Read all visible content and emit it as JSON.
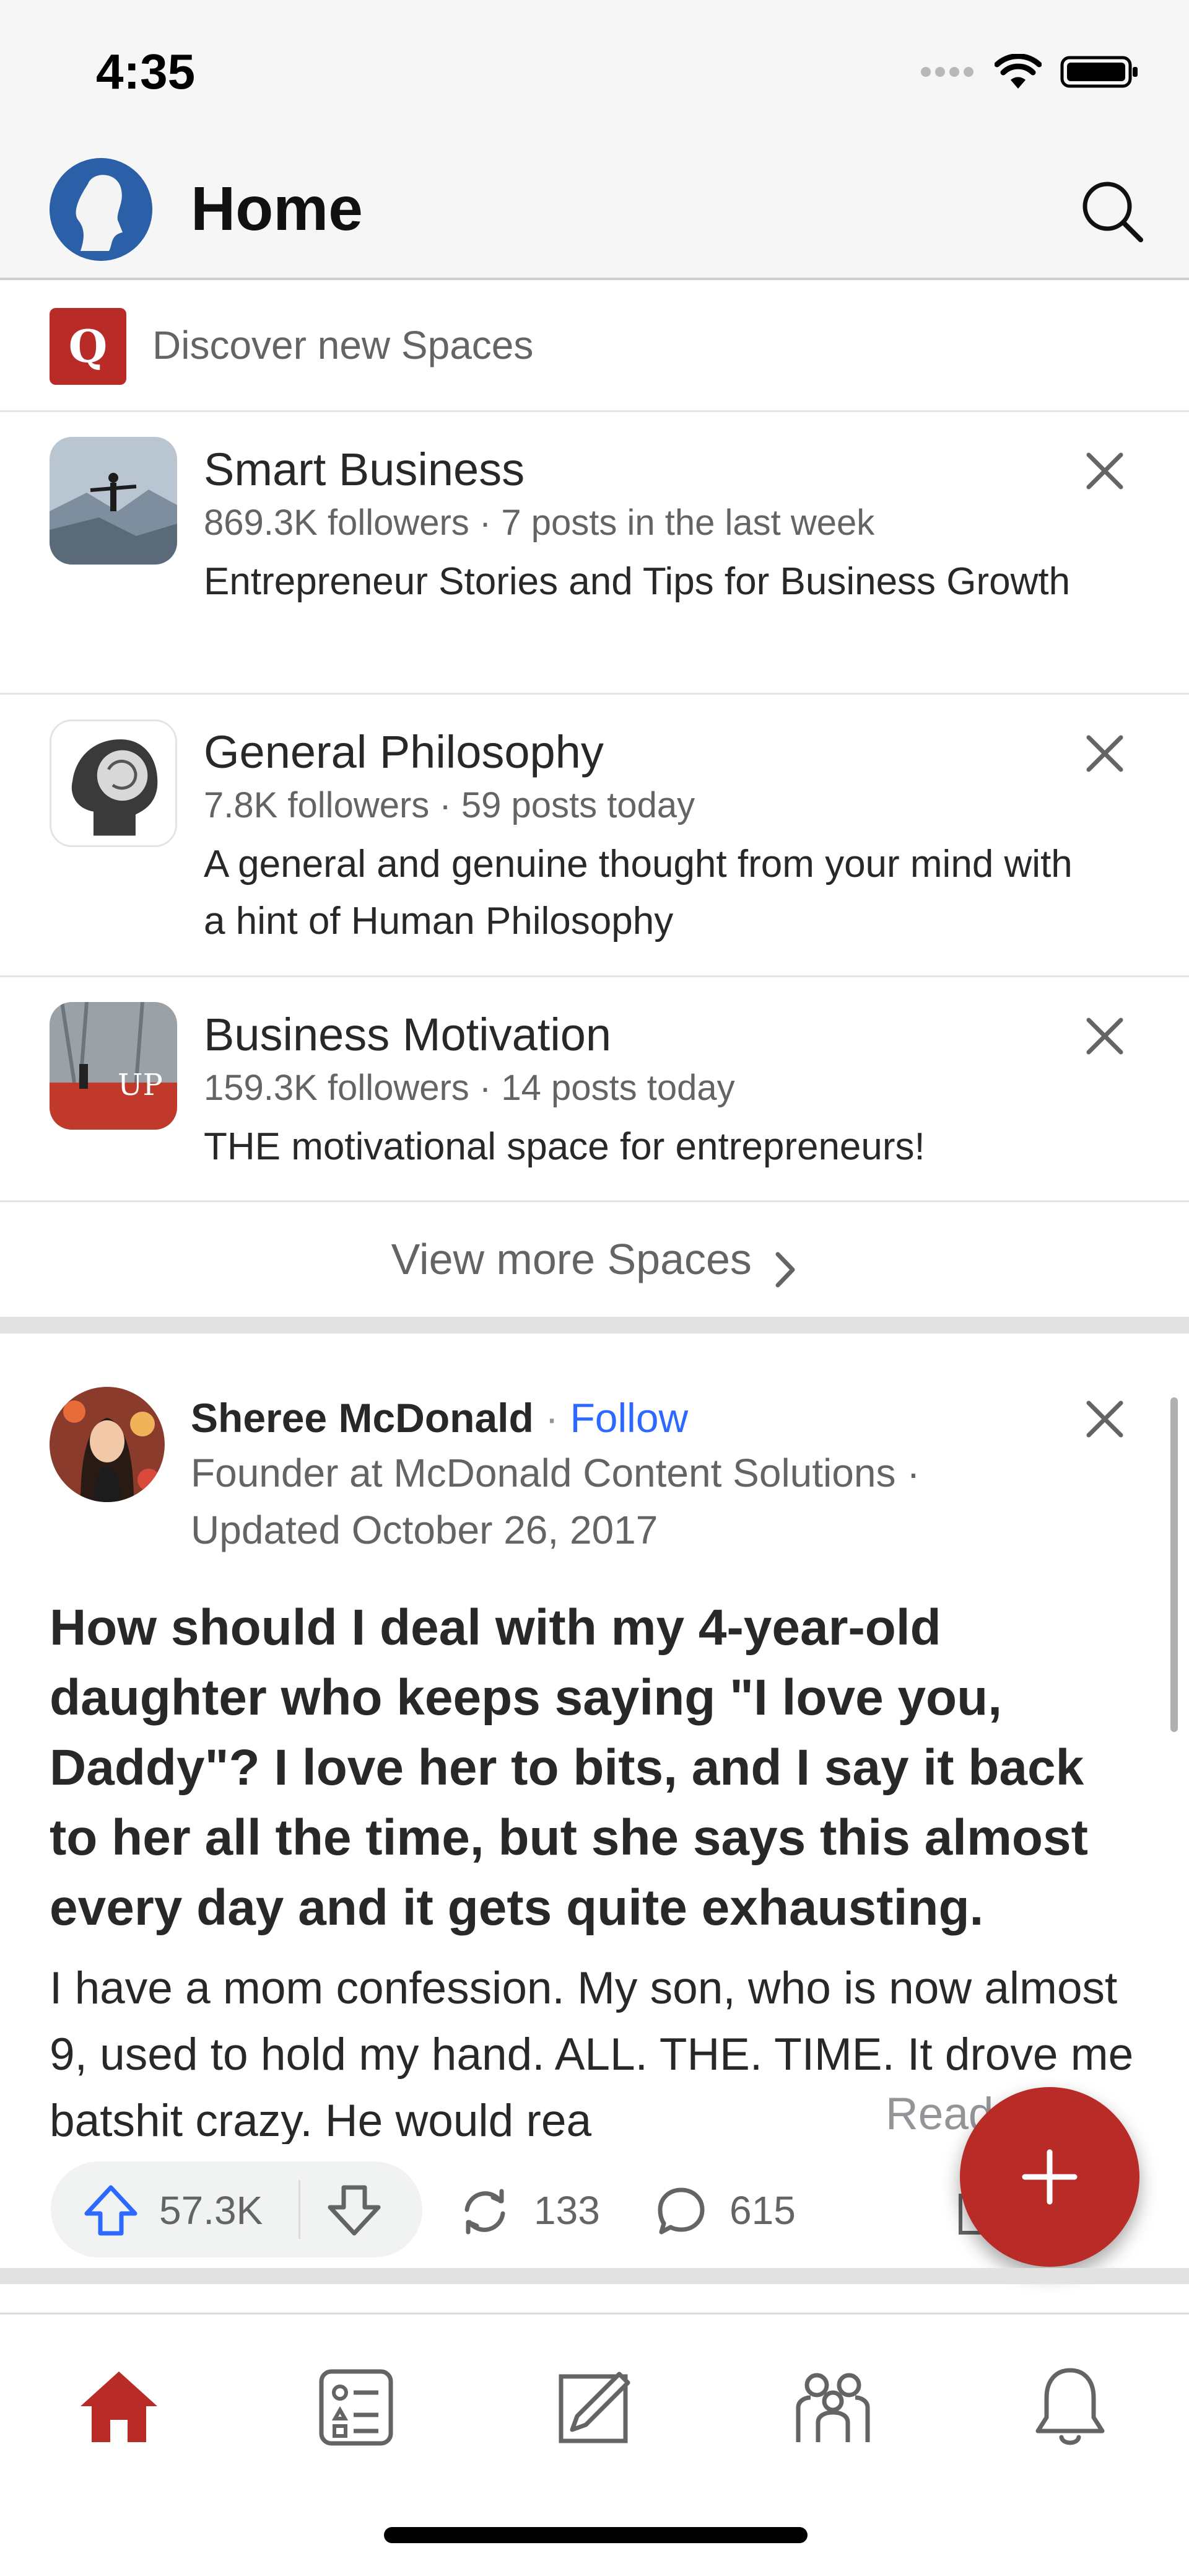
{
  "status_bar": {
    "time": "4:35"
  },
  "header": {
    "title": "Home"
  },
  "discover": {
    "logo_letter": "Q",
    "label": "Discover new Spaces"
  },
  "spaces": [
    {
      "name": "Smart Business",
      "meta": "869.3K followers · 7 posts in the last week",
      "description": "Entrepreneur Stories and Tips for Business Growth"
    },
    {
      "name": "General Philosophy",
      "meta": "7.8K followers · 59 posts today",
      "description": "A general and genuine thought from your mind with a hint of Human Philosophy"
    },
    {
      "name": "Business Motivation",
      "meta": "159.3K followers · 14 posts today",
      "description": "THE motivational space for entrepreneurs!",
      "thumb_text": "UP"
    }
  ],
  "view_more_label": "View more Spaces",
  "post": {
    "author": "Sheree McDonald",
    "separator": " · ",
    "follow_label": "Follow",
    "credential": "Founder at McDonald Content Solutions ·",
    "updated": "Updated October 26, 2017",
    "question": "How should I deal with my 4-year-old daughter who keeps saying \"I love you, Daddy\"? I love her to bits, and I say it back to her all the time, but she says this almost every day and it gets quite exhausting.",
    "answer_preview": "I have a mom confession. My son, who is now almost 9, used to hold my hand. ALL. THE. TIME. It drove me batshit crazy. He would rea",
    "read_more": "Read more",
    "upvotes": "57.3K",
    "shares": "133",
    "comments": "615"
  },
  "colors": {
    "brand_red": "#b92b27",
    "link_blue": "#2e69ff",
    "upvote_blue": "#2e69ff"
  }
}
